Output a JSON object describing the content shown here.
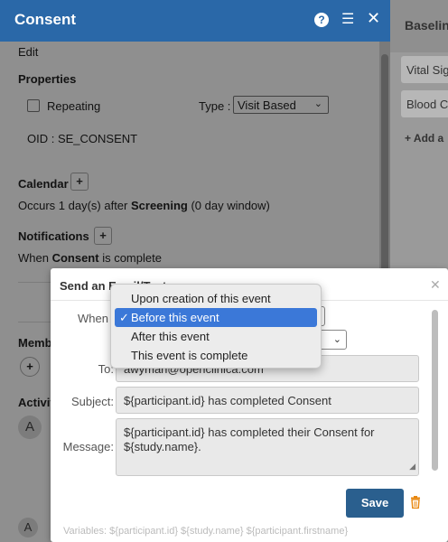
{
  "background_panel": {
    "title": "Baselin",
    "cards": [
      "Vital Sig",
      "Blood C"
    ],
    "add_label": "+ Add a"
  },
  "panel": {
    "title": "Consent",
    "edit_label": "Edit",
    "properties_heading": "Properties",
    "repeating_label": "Repeating",
    "repeating_checked": false,
    "type_label": "Type :",
    "type_value": "Visit Based",
    "oid_label": "OID : SE_CONSENT",
    "calendar_heading": "Calendar",
    "occurs_prefix": "Occurs 1 day(s) after ",
    "occurs_event": "Screening",
    "occurs_suffix": " (0 day window)",
    "notifications_heading": "Notifications",
    "when_prefix": "When ",
    "when_event": "Consent",
    "when_suffix": " is complete",
    "members_heading": "Memb",
    "activity_heading": "Activit",
    "avatar_letter": "A",
    "avatar2_letter": "A"
  },
  "modal": {
    "title": "Send an Email/Text",
    "when_label": "When",
    "to_label": "To:",
    "to_value": "awyman@openclinica.com",
    "subject_label": "Subject:",
    "subject_value": "${participant.id} has completed Consent",
    "message_label": "Message:",
    "message_value": "${participant.id} has completed their Consent for ${study.name}.",
    "save_label": "Save",
    "footer_text": "Variables: ${participant.id}  ${study.name}  ${participant.firstname}"
  },
  "dropdown": {
    "options": [
      "Upon creation of this event",
      "Before this event",
      "After this event",
      "This event is complete"
    ],
    "selected_index": 1
  },
  "colors": {
    "header_blue": "#2a68a8",
    "save_button": "#2a5f8e",
    "selected_option": "#3b78d8",
    "trash_orange": "#e8870f"
  }
}
